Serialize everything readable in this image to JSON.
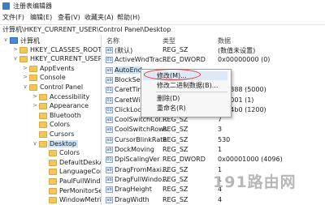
{
  "window": {
    "title": "注册表编辑器",
    "icon": "regedit-icon"
  },
  "menu": [
    "文件(F)",
    "编辑(E)",
    "查看(V)",
    "收藏夹(A)",
    "帮助(H)"
  ],
  "address": "计算机\\HKEY_CURRENT_USER\\Control Panel\\Desktop",
  "tree": [
    {
      "label": "计算机",
      "icon": "computer-icon",
      "arrow": "∨"
    },
    {
      "label": "HKEY_CLASSES_ROOT",
      "icon": "folder-icon",
      "arrow": ">"
    },
    {
      "label": "HKEY_CURRENT_USER",
      "icon": "folder-icon",
      "arrow": "∨"
    },
    {
      "label": "AppEvents",
      "icon": "folder-icon",
      "arrow": ">"
    },
    {
      "label": "Console",
      "icon": "folder-icon",
      "arrow": ">"
    },
    {
      "label": "Control Panel",
      "icon": "folder-icon",
      "arrow": "∨"
    },
    {
      "label": "Accessibility",
      "icon": "folder-icon",
      "arrow": ">"
    },
    {
      "label": "Appearance",
      "icon": "folder-icon",
      "arrow": ">"
    },
    {
      "label": "Bluetooth",
      "icon": "folder-icon",
      "arrow": ""
    },
    {
      "label": "Colors",
      "icon": "folder-icon",
      "arrow": ""
    },
    {
      "label": "Cursors",
      "icon": "folder-icon",
      "arrow": ""
    },
    {
      "label": "Desktop",
      "icon": "folder-icon",
      "arrow": "∨",
      "selected": true
    },
    {
      "label": "Colors",
      "icon": "folder-icon",
      "arrow": ""
    },
    {
      "label": "DefaultDeskAss",
      "icon": "folder-icon",
      "arrow": ""
    },
    {
      "label": "LanguageConfig",
      "icon": "folder-icon",
      "arrow": ""
    },
    {
      "label": "PaulFullWindo",
      "icon": "folder-icon",
      "arrow": ""
    },
    {
      "label": "PerMonitorSetti",
      "icon": "folder-icon",
      "arrow": ""
    },
    {
      "label": "WindowMetrics",
      "icon": "folder-icon",
      "arrow": ""
    }
  ],
  "columns": {
    "name": "名称",
    "type": "类型",
    "data": "数据"
  },
  "values": [
    {
      "name": "(默认)",
      "type": "REG_SZ",
      "data": "(数值未设置)",
      "kind": "ab"
    },
    {
      "name": "ActiveWndTrac...",
      "type": "REG_DWORD",
      "data": "0x00000000 (0)",
      "kind": "01"
    },
    {
      "name": "AutoEnd",
      "type": "",
      "data": "",
      "kind": "ab",
      "selected": true
    },
    {
      "name": "BlockSen",
      "type": "",
      "data": "",
      "kind": "ab"
    },
    {
      "name": "CaretTim",
      "type": "",
      "data": "001388 (5000)",
      "kind": "01"
    },
    {
      "name": "CaretWid",
      "type": "",
      "data": "000001 (1)",
      "kind": "01"
    },
    {
      "name": "ClickLock",
      "type": "",
      "data": "0004b0 (1200)",
      "kind": "01"
    },
    {
      "name": "CoolSwitchCol...",
      "type": "REG_SZ",
      "data": "7",
      "kind": "ab"
    },
    {
      "name": "CoolSwitchRows",
      "type": "REG_SZ",
      "data": "3",
      "kind": "ab"
    },
    {
      "name": "CursorBlinkRate",
      "type": "REG_SZ",
      "data": "530",
      "kind": "ab"
    },
    {
      "name": "DockMoving",
      "type": "REG_SZ",
      "data": "1",
      "kind": "ab"
    },
    {
      "name": "DpiScalingVer",
      "type": "REG_DWORD",
      "data": "0x00001000 (4096)",
      "kind": "01"
    },
    {
      "name": "DragFromMaxi...",
      "type": "REG_SZ",
      "data": "1",
      "kind": "ab"
    },
    {
      "name": "DragFullWindo...",
      "type": "REG_SZ",
      "data": "1",
      "kind": "ab"
    },
    {
      "name": "DragHeight",
      "type": "REG_SZ",
      "data": "4",
      "kind": "ab"
    },
    {
      "name": "DragWidth",
      "type": "REG_SZ",
      "data": "4",
      "kind": "ab"
    }
  ],
  "context_menu": {
    "items": [
      "修改(M)...",
      "修改二进制数据(B)...",
      "删除(D)",
      "重命名(R)"
    ],
    "highlighted": "修改(M)..."
  },
  "watermark": "191路由网"
}
